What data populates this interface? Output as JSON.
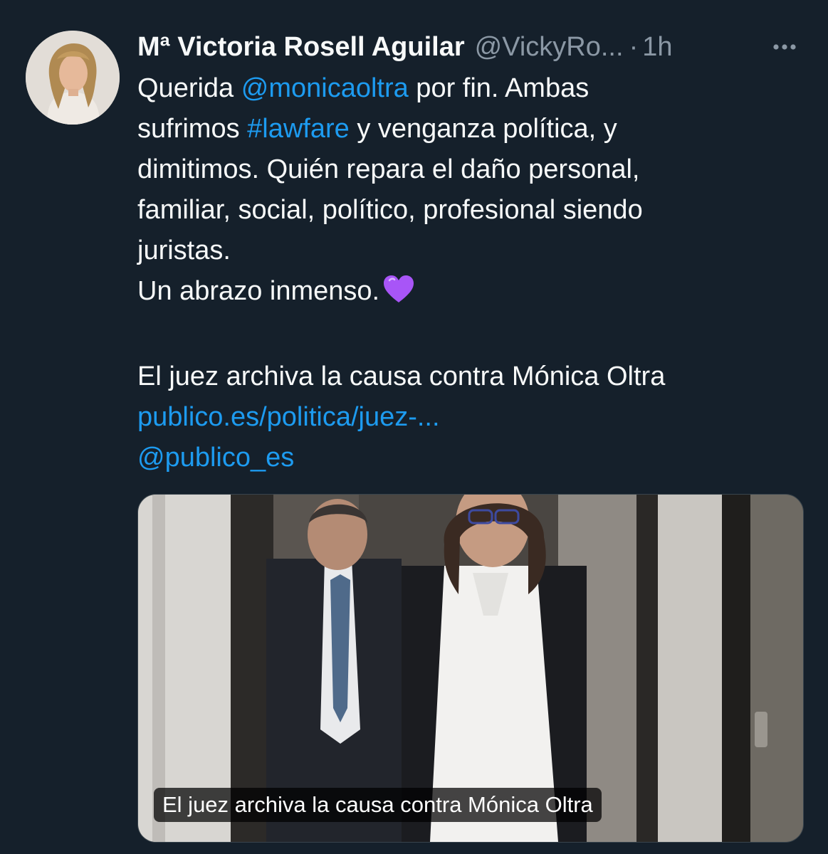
{
  "tweet": {
    "display_name": "Mª Victoria Rosell Aguilar",
    "handle": "@VickyRo...",
    "separator": "·",
    "time": "1h",
    "more_icon": "more-horizontal-icon",
    "lines": {
      "l1_pre": "Querida ",
      "l1_mention": "@monicaoltra",
      "l1_post": " por fin. Ambas",
      "l2_pre": "sufrimos ",
      "l2_hashtag": "#lawfare",
      "l2_post": " y venganza política, y",
      "l3": "dimitimos. Quién repara el daño personal,",
      "l4": "familiar, social, político, profesional siendo",
      "l5": "juristas.",
      "l6": "Un abrazo inmenso.",
      "l8": "El juez archiva la causa contra Mónica Oltra",
      "l9_link": "publico.es/politica/juez-...",
      "l10_mention": "@publico_es"
    },
    "emoji": "purple-heart-icon"
  },
  "card": {
    "caption": "El juez archiva la causa contra Mónica Oltra"
  },
  "colors": {
    "background": "#15202b",
    "text": "#f7f9f9",
    "secondary": "#8b98a5",
    "accent": "#1d9bf0",
    "heart": "#a855f7"
  }
}
